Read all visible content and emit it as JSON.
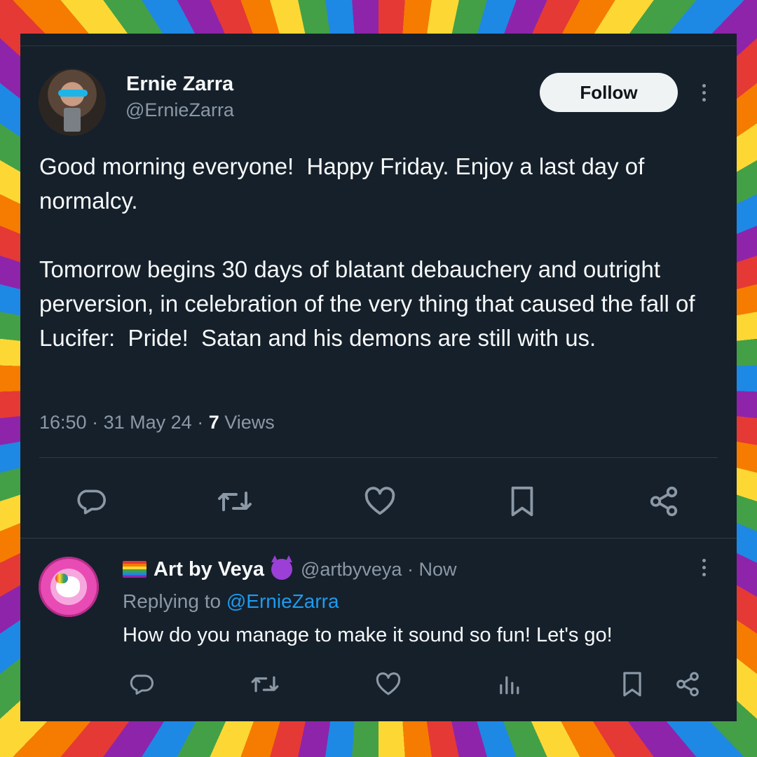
{
  "colors": {
    "background": "#15202b",
    "text": "#f7f9f9",
    "muted": "#8b98a5",
    "link": "#1d9bf0",
    "follow_bg": "#eff3f4"
  },
  "tweet": {
    "author_name": "Ernie Zarra",
    "author_handle": "@ErnieZarra",
    "follow_label": "Follow",
    "text": "Good morning everyone!  Happy Friday. Enjoy a last day of normalcy.\n\nTomorrow begins 30 days of blatant debauchery and outright perversion, in celebration of the very thing that caused the fall of Lucifer:  Pride!  Satan and his demons are still with us.",
    "time": "16:50",
    "date": "31 May 24",
    "views_count": "7",
    "views_label": "Views",
    "actions": [
      "reply-icon",
      "retweet-icon",
      "like-icon",
      "bookmark-icon",
      "share-icon"
    ]
  },
  "reply": {
    "author_name": "Art by Veya",
    "author_handle": "@artbyveya",
    "time": "Now",
    "replying_label": "Replying to",
    "replying_handle": "@ErnieZarra",
    "text": "How do you manage to make it sound so fun! Let's go!",
    "actions": [
      "reply-icon",
      "retweet-icon",
      "like-icon",
      "views-icon",
      "bookmark-icon",
      "share-icon"
    ]
  }
}
